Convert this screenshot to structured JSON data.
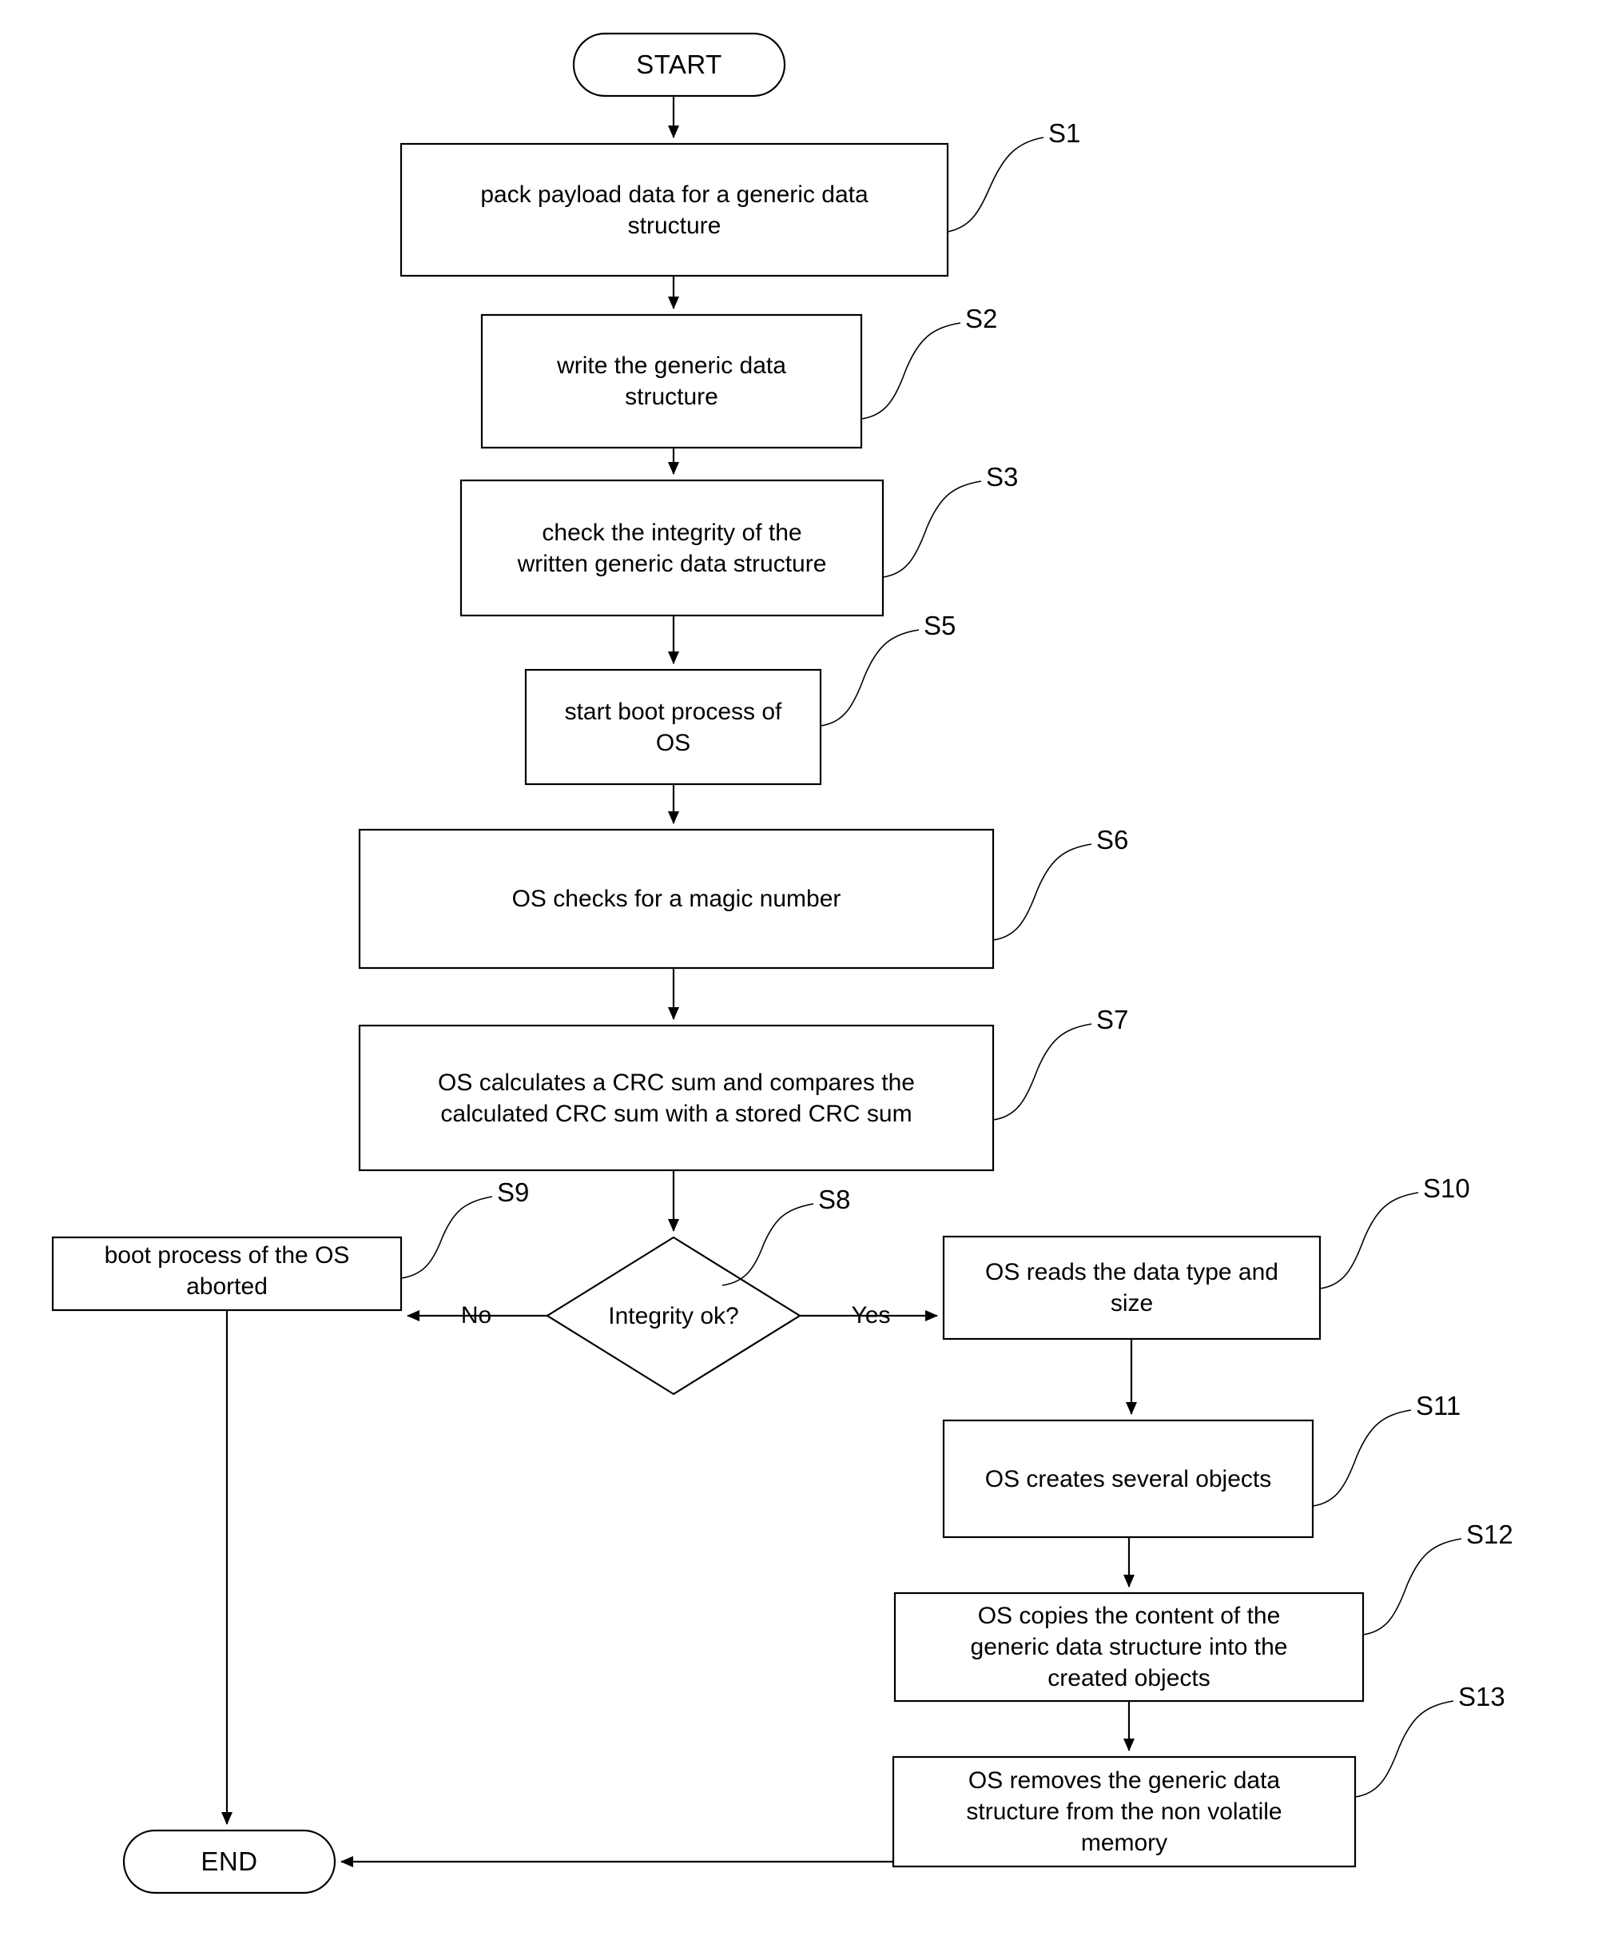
{
  "diagram": {
    "title": "OS generic data structure boot flowchart",
    "stroke_color": "#000000",
    "fill_color": "#ffffff",
    "background": "#ffffff"
  },
  "nodes": {
    "start": {
      "label": "START",
      "shape": "terminator"
    },
    "s1": {
      "label": "pack payload data  for a generic data\nstructure",
      "shape": "process",
      "ref": "S1"
    },
    "s2": {
      "label": "write the generic data\nstructure",
      "shape": "process",
      "ref": "S2"
    },
    "s3": {
      "label": "check the integrity of the\nwritten generic data structure",
      "shape": "process",
      "ref": "S3"
    },
    "s5": {
      "label": "start boot process of\nOS",
      "shape": "process",
      "ref": "S5"
    },
    "s6": {
      "label": "OS checks for a magic number",
      "shape": "process",
      "ref": "S6"
    },
    "s7": {
      "label": "OS calculates a CRC sum and compares the\ncalculated CRC sum with a stored CRC sum",
      "shape": "process",
      "ref": "S7"
    },
    "s8": {
      "label": "Integrity ok?",
      "shape": "decision",
      "ref": "S8"
    },
    "s9": {
      "label": "boot process of the OS\naborted",
      "shape": "process",
      "ref": "S9"
    },
    "s10": {
      "label": "OS reads the data type and\nsize",
      "shape": "process",
      "ref": "S10"
    },
    "s11": {
      "label": "OS creates several objects",
      "shape": "process",
      "ref": "S11"
    },
    "s12": {
      "label": "OS copies the content of the\ngeneric data structure into the\ncreated objects",
      "shape": "process",
      "ref": "S12"
    },
    "s13": {
      "label": "OS removes the generic data\nstructure from the non volatile\nmemory",
      "shape": "process",
      "ref": "S13"
    },
    "end": {
      "label": "END",
      "shape": "terminator"
    }
  },
  "refs": {
    "s1": "S1",
    "s2": "S2",
    "s3": "S3",
    "s5": "S5",
    "s6": "S6",
    "s7": "S7",
    "s8": "S8",
    "s9": "S9",
    "s10": "S10",
    "s11": "S11",
    "s12": "S12",
    "s13": "S13"
  },
  "edge_labels": {
    "no": "No",
    "yes": "Yes"
  },
  "flow": [
    {
      "from": "start",
      "to": "s1",
      "label": ""
    },
    {
      "from": "s1",
      "to": "s2",
      "label": ""
    },
    {
      "from": "s2",
      "to": "s3",
      "label": ""
    },
    {
      "from": "s3",
      "to": "s5",
      "label": ""
    },
    {
      "from": "s5",
      "to": "s6",
      "label": ""
    },
    {
      "from": "s6",
      "to": "s7",
      "label": ""
    },
    {
      "from": "s7",
      "to": "s8",
      "label": ""
    },
    {
      "from": "s8",
      "to": "s9",
      "label": "No"
    },
    {
      "from": "s8",
      "to": "s10",
      "label": "Yes"
    },
    {
      "from": "s10",
      "to": "s11",
      "label": ""
    },
    {
      "from": "s11",
      "to": "s12",
      "label": ""
    },
    {
      "from": "s12",
      "to": "s13",
      "label": ""
    },
    {
      "from": "s13",
      "to": "end",
      "label": ""
    },
    {
      "from": "s9",
      "to": "end",
      "label": ""
    }
  ]
}
